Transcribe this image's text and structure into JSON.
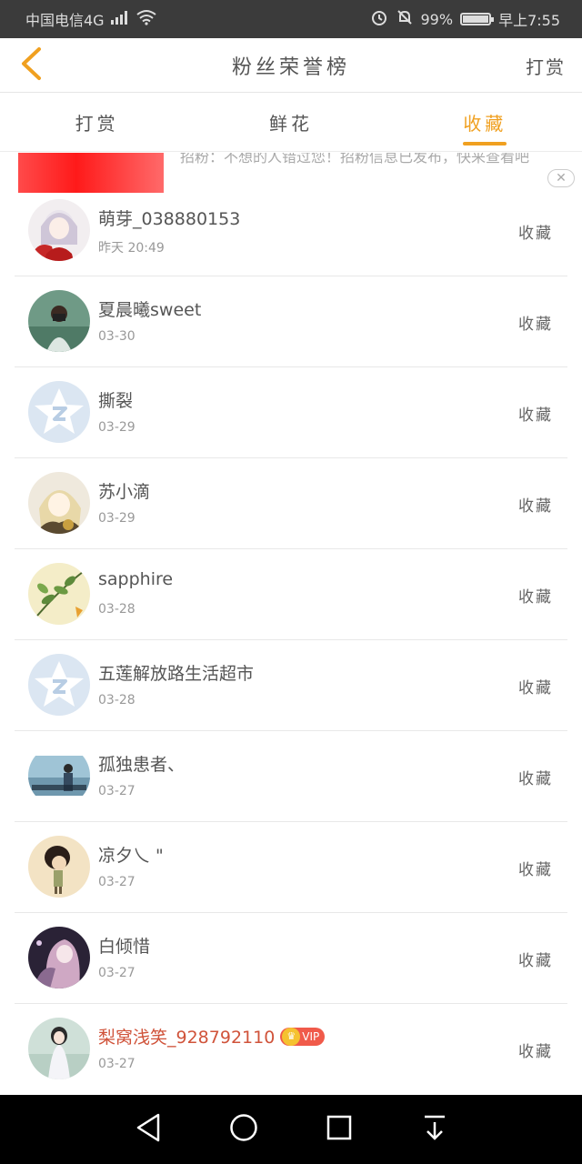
{
  "status_bar": {
    "carrier": "中国电信4G",
    "network": "4G",
    "battery": "99%",
    "battery_level": 0.99,
    "time": "早上7:55"
  },
  "header": {
    "title": "粉丝荣誉榜",
    "action_label": "打赏",
    "back_icon": "chevron-left-icon"
  },
  "tabs": [
    {
      "label": "打赏",
      "active": false
    },
    {
      "label": "鲜花",
      "active": false
    },
    {
      "label": "收藏",
      "active": true
    }
  ],
  "ad": {
    "text": "招粉：不想的人错过您！招粉信息已发布，快来查看吧",
    "close": "✕"
  },
  "list": [
    {
      "name": "萌芽_038880153",
      "date": "昨天 20:49",
      "action": "收藏",
      "avatar": "anime-girl-red"
    },
    {
      "name": "夏晨曦sweet",
      "date": "03-30",
      "action": "收藏",
      "avatar": "photo-girl-camera"
    },
    {
      "name": "撕裂",
      "date": "03-29",
      "action": "收藏",
      "avatar": "default-qq-star"
    },
    {
      "name": "苏小滴",
      "date": "03-29",
      "action": "收藏",
      "avatar": "anime-girl-blonde"
    },
    {
      "name": "sapphire",
      "date": "03-28",
      "action": "收藏",
      "avatar": "plant-leaves"
    },
    {
      "name": "五莲解放路生活超市",
      "date": "03-28",
      "action": "收藏",
      "avatar": "default-qq-star"
    },
    {
      "name": "孤独患者、",
      "date": "03-27",
      "action": "收藏",
      "avatar": "photo-person-sea"
    },
    {
      "name": "凉夕乀 \"",
      "date": "03-27",
      "action": "收藏",
      "avatar": "photo-figure-beige"
    },
    {
      "name": "白倾惜",
      "date": "03-27",
      "action": "收藏",
      "avatar": "anime-girl-dark"
    },
    {
      "name": "梨窝浅笑_928792110",
      "date": "03-27",
      "action": "收藏",
      "avatar": "photo-girl-white",
      "vip": true,
      "vip_label": "VIP"
    }
  ],
  "colors": {
    "accent": "#f0a020",
    "vip_name": "#d0533a",
    "status_bar": "#3b3b3b"
  }
}
